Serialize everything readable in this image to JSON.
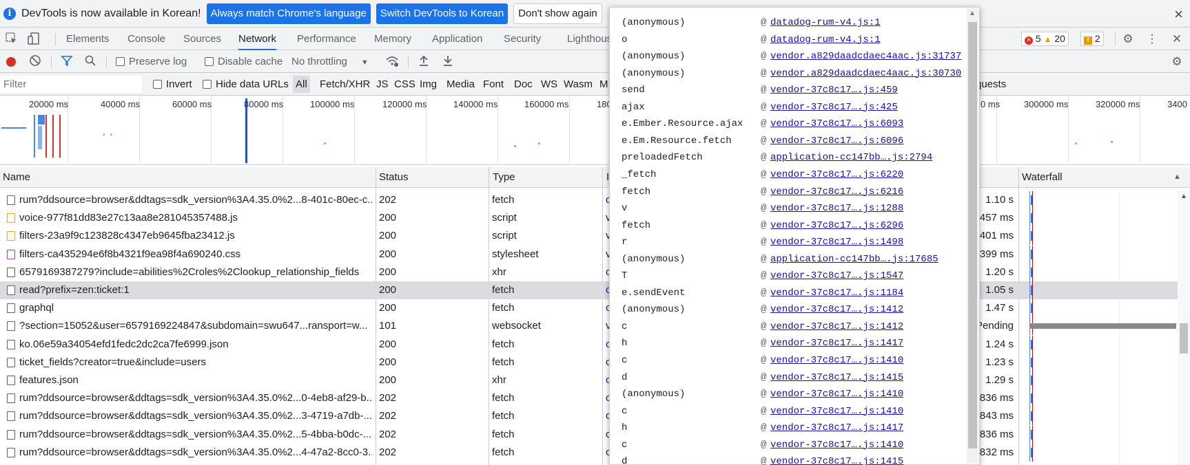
{
  "infobar": {
    "message": "DevTools is now available in Korean!",
    "btn_match": "Always match Chrome's language",
    "btn_switch": "Switch DevTools to Korean",
    "btn_dismiss": "Don't show again",
    "close": "×"
  },
  "tabs": {
    "elements": "Elements",
    "console": "Console",
    "sources": "Sources",
    "network": "Network",
    "performance": "Performance",
    "memory": "Memory",
    "application": "Application",
    "security": "Security",
    "lighthouse": "Lighthous"
  },
  "badges": {
    "errors": "5",
    "warnings": "20",
    "issues": "2"
  },
  "toolbar": {
    "preserve_log": "Preserve log",
    "disable_cache": "Disable cache",
    "throttling": "No throttling"
  },
  "filterbar": {
    "placeholder": "Filter",
    "invert": "Invert",
    "hide_data_urls": "Hide data URLs",
    "types": [
      "All",
      "Fetch/XHR",
      "JS",
      "CSS",
      "Img",
      "Media",
      "Font",
      "Doc",
      "WS",
      "Wasm",
      "M"
    ],
    "requests_tail": "quests"
  },
  "overview": {
    "ticks": [
      "20000 ms",
      "40000 ms",
      "60000 ms",
      "80000 ms",
      "100000 ms",
      "120000 ms",
      "140000 ms",
      "160000 ms",
      "180",
      "0 ms",
      "300000 ms",
      "320000 ms",
      "3400"
    ]
  },
  "columns": {
    "name": "Name",
    "status": "Status",
    "type": "Type",
    "initiator": "In",
    "waterfall": "Waterfall"
  },
  "rows": [
    {
      "name": "rum?ddsource=browser&ddtags=sdk_version%3A4.35.0%2...8-401c-80ec-c...",
      "status": "202",
      "type": "fetch",
      "ini": "c",
      "time": "1.10 s",
      "icon": "doc"
    },
    {
      "name": "voice-977f81dd83e27c13aa8e281045357488.js",
      "status": "200",
      "type": "script",
      "ini": "v",
      "time": "457 ms",
      "icon": "js"
    },
    {
      "name": "filters-23a9f9c123828c4347eb9645fba23412.js",
      "status": "200",
      "type": "script",
      "ini": "v",
      "time": "401 ms",
      "icon": "js"
    },
    {
      "name": "filters-ca435294e6f8b4321f9ea98f4a690240.css",
      "status": "200",
      "type": "stylesheet",
      "ini": "v",
      "time": "399 ms",
      "icon": "css"
    },
    {
      "name": "6579169387279?include=abilities%2Croles%2Clookup_relationship_fields",
      "status": "200",
      "type": "xhr",
      "ini": "c",
      "time": "1.20 s",
      "icon": "doc"
    },
    {
      "name": "read?prefix=zen:ticket:1",
      "status": "200",
      "type": "fetch",
      "ini": "c",
      "time": "1.05 s",
      "icon": "doc"
    },
    {
      "name": "graphql",
      "status": "200",
      "type": "fetch",
      "ini": "c",
      "time": "1.47 s",
      "icon": "doc"
    },
    {
      "name": "?section=15052&user=6579169224847&subdomain=swu647...ransport=w...",
      "status": "101",
      "type": "websocket",
      "ini": "v",
      "time": "Pending",
      "icon": "doc"
    },
    {
      "name": "ko.06e59a34054efd1fedc2dc2ca7fe6999.json",
      "status": "200",
      "type": "fetch",
      "ini": "c",
      "time": "1.24 s",
      "icon": "doc"
    },
    {
      "name": "ticket_fields?creator=true&include=users",
      "status": "200",
      "type": "fetch",
      "ini": "c",
      "time": "1.23 s",
      "icon": "doc"
    },
    {
      "name": "features.json",
      "status": "200",
      "type": "xhr",
      "ini": "c",
      "time": "1.29 s",
      "icon": "doc"
    },
    {
      "name": "rum?ddsource=browser&ddtags=sdk_version%3A4.35.0%2...0-4eb8-af29-b...",
      "status": "202",
      "type": "fetch",
      "ini": "c",
      "time": "836 ms",
      "icon": "doc"
    },
    {
      "name": "rum?ddsource=browser&ddtags=sdk_version%3A4.35.0%2...3-4719-a7db-...",
      "status": "202",
      "type": "fetch",
      "ini": "c",
      "time": "843 ms",
      "icon": "doc"
    },
    {
      "name": "rum?ddsource=browser&ddtags=sdk_version%3A4.35.0%2...5-4bba-b0dc-...",
      "status": "202",
      "type": "fetch",
      "ini": "c",
      "time": "836 ms",
      "icon": "doc"
    },
    {
      "name": "rum?ddsource=browser&ddtags=sdk_version%3A4.35.0%2...4-47a2-8cc0-3...",
      "status": "202",
      "type": "fetch",
      "ini": "c",
      "time": "832 ms",
      "icon": "doc"
    }
  ],
  "stack": [
    {
      "fn": "(anonymous)",
      "link": "datadog-rum-v4.js:1"
    },
    {
      "fn": "o",
      "link": "datadog-rum-v4.js:1"
    },
    {
      "fn": "(anonymous)",
      "link": "vendor.a829daadcdaec4aac.js:31737"
    },
    {
      "fn": "(anonymous)",
      "link": "vendor.a829daadcdaec4aac.js:30730"
    },
    {
      "fn": "send",
      "link": "vendor-37c8c17….js:459"
    },
    {
      "fn": "ajax",
      "link": "vendor-37c8c17….js:425"
    },
    {
      "fn": "e.Ember.Resource.ajax",
      "link": "vendor-37c8c17….js:6093"
    },
    {
      "fn": "e.Em.Resource.fetch",
      "link": "vendor-37c8c17….js:6096"
    },
    {
      "fn": "preloadedFetch",
      "link": "application-cc147bb….js:2794"
    },
    {
      "fn": "_fetch",
      "link": "vendor-37c8c17….js:6220"
    },
    {
      "fn": "fetch",
      "link": "vendor-37c8c17….js:6216"
    },
    {
      "fn": "v",
      "link": "vendor-37c8c17….js:1288"
    },
    {
      "fn": "fetch",
      "link": "vendor-37c8c17….js:6296"
    },
    {
      "fn": "r",
      "link": "vendor-37c8c17….js:1498"
    },
    {
      "fn": "(anonymous)",
      "link": "application-cc147bb….js:17685"
    },
    {
      "fn": "T",
      "link": "vendor-37c8c17….js:1547"
    },
    {
      "fn": "e.sendEvent",
      "link": "vendor-37c8c17….js:1184"
    },
    {
      "fn": "(anonymous)",
      "link": "vendor-37c8c17….js:1412"
    },
    {
      "fn": "c",
      "link": "vendor-37c8c17….js:1412"
    },
    {
      "fn": "h",
      "link": "vendor-37c8c17….js:1417"
    },
    {
      "fn": "c",
      "link": "vendor-37c8c17….js:1410"
    },
    {
      "fn": "d",
      "link": "vendor-37c8c17….js:1415"
    },
    {
      "fn": "(anonymous)",
      "link": "vendor-37c8c17….js:1410"
    },
    {
      "fn": "c",
      "link": "vendor-37c8c17….js:1410"
    },
    {
      "fn": "h",
      "link": "vendor-37c8c17….js:1417"
    },
    {
      "fn": "c",
      "link": "vendor-37c8c17….js:1410"
    },
    {
      "fn": "d",
      "link": "vendor-37c8c17….js:1415"
    }
  ],
  "stack_at": "@"
}
